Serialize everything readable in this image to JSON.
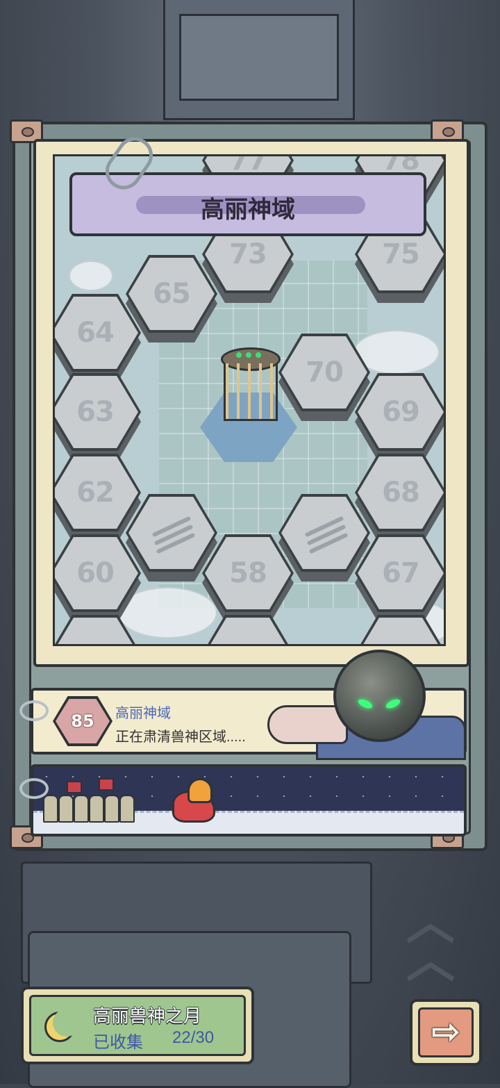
{
  "map": {
    "title": "高丽神域",
    "tiles": [
      {
        "label": "77"
      },
      {
        "label": "78"
      },
      {
        "label": "73"
      },
      {
        "label": "75"
      },
      {
        "label": "65"
      },
      {
        "label": "64"
      },
      {
        "label": "70"
      },
      {
        "label": "63"
      },
      {
        "label": "69"
      },
      {
        "label": "62"
      },
      {
        "label": "68"
      },
      {
        "label": "60"
      },
      {
        "label": "58"
      },
      {
        "label": "67"
      }
    ]
  },
  "current_zone": {
    "level": "85",
    "name": "高丽神域",
    "status": "正在肃清兽神区域....."
  },
  "collection": {
    "title": "高丽兽神之月",
    "collected_label": "已收集",
    "count": "22/30"
  },
  "next_button": {
    "icon": "arrow-right-icon",
    "glyph": "⇨"
  }
}
